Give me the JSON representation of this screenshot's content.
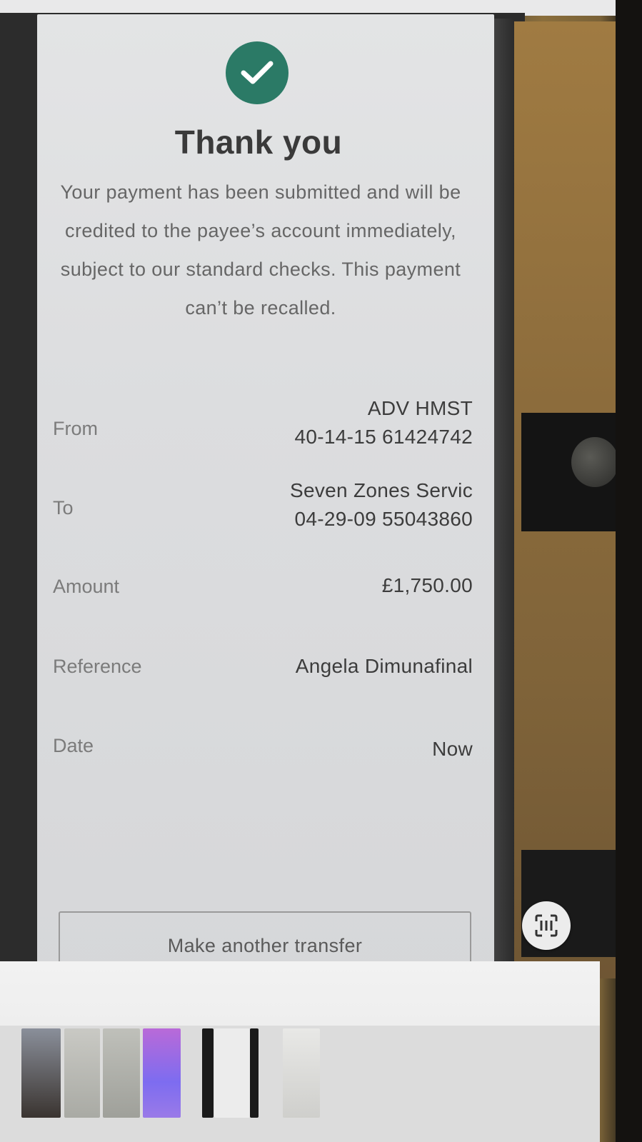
{
  "confirmation": {
    "title": "Thank you",
    "message": "Your payment has been submitted and will be credited to the payee’s account immediately, subject to our standard checks. This payment can’t be recalled.",
    "icon": "check-icon",
    "accent_color": "#2b7a66"
  },
  "details": {
    "from": {
      "label": "From",
      "name": "ADV HMST",
      "account": "40-14-15 61424742"
    },
    "to": {
      "label": "To",
      "name": "Seven Zones Servic",
      "account": "04-29-09 55043860"
    },
    "amount": {
      "label": "Amount",
      "value": "£1,750.00"
    },
    "reference": {
      "label": "Reference",
      "value": "Angela Dimunafinal"
    },
    "date": {
      "label": "Date",
      "value": "Now"
    }
  },
  "actions": {
    "make_another_transfer": "Make another transfer"
  },
  "fab": {
    "icon": "scan-icon"
  }
}
